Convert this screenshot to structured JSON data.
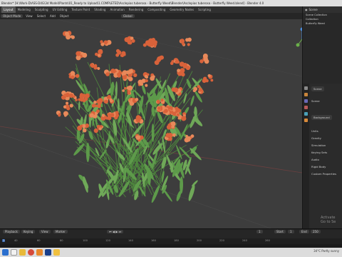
{
  "title_bar": {
    "text": "Blender* [H:\\Work-D\\ASS-D4G\\3d Model\\Plants\\01_Ready to Upload\\1.COMPLETED\\Asclepias tuberosa - Butterfly Weed\\Blender\\Asclepias tuberosa - Butterfly Weed.blend] - Blender 4.0"
  },
  "menubar": {
    "tabs": [
      "Layout",
      "Modeling",
      "Sculpting",
      "UV Editing",
      "Texture Paint",
      "Shading",
      "Animation",
      "Rendering",
      "Compositing",
      "Geometry Nodes",
      "Scripting"
    ],
    "active_index": 0
  },
  "viewport_header": {
    "mode": "Object Mode",
    "view": "View",
    "select": "Select",
    "add": "Add",
    "object": "Object",
    "orientation": "Global"
  },
  "outliner": {
    "title": "Scene",
    "rows": [
      "Scene Collection",
      "Collection",
      "Butterfly Weed"
    ]
  },
  "options_label": "Options",
  "properties": {
    "scene_label": "Scene",
    "rows": [
      "Scene",
      "Background",
      "Units",
      "Gravity",
      "Simulation",
      "Keying Sets",
      "Audio",
      "Rigid Body",
      "Custom Properties"
    ]
  },
  "nav_buttons": [
    "+",
    "hand",
    "camera",
    "grid"
  ],
  "timeline": {
    "playback": "Playback",
    "keying": "Keying",
    "view": "View",
    "marker": "Marker",
    "current_frame": "1",
    "start": "Start",
    "start_value": "1",
    "end": "End",
    "end_value": "250"
  },
  "ruler_ticks": [
    "0",
    "40",
    "60",
    "80",
    "100",
    "120",
    "140",
    "160",
    "180",
    "200",
    "220",
    "240",
    "260"
  ],
  "ruler_current": "1",
  "taskbar": {
    "weather": "34°C Partly sunny",
    "apps": [
      "start",
      "search",
      "explorer",
      "chrome",
      "blender",
      "photoshop",
      "folder"
    ]
  },
  "watermark": {
    "line1": "Activate",
    "line2": "Go to Se"
  },
  "colors": {
    "viewport_bg": "#3d3d3d",
    "flower": "#d9623a",
    "leaf": "#6fa858",
    "accent": "#3d6cb1",
    "active_tab": "#595959"
  }
}
